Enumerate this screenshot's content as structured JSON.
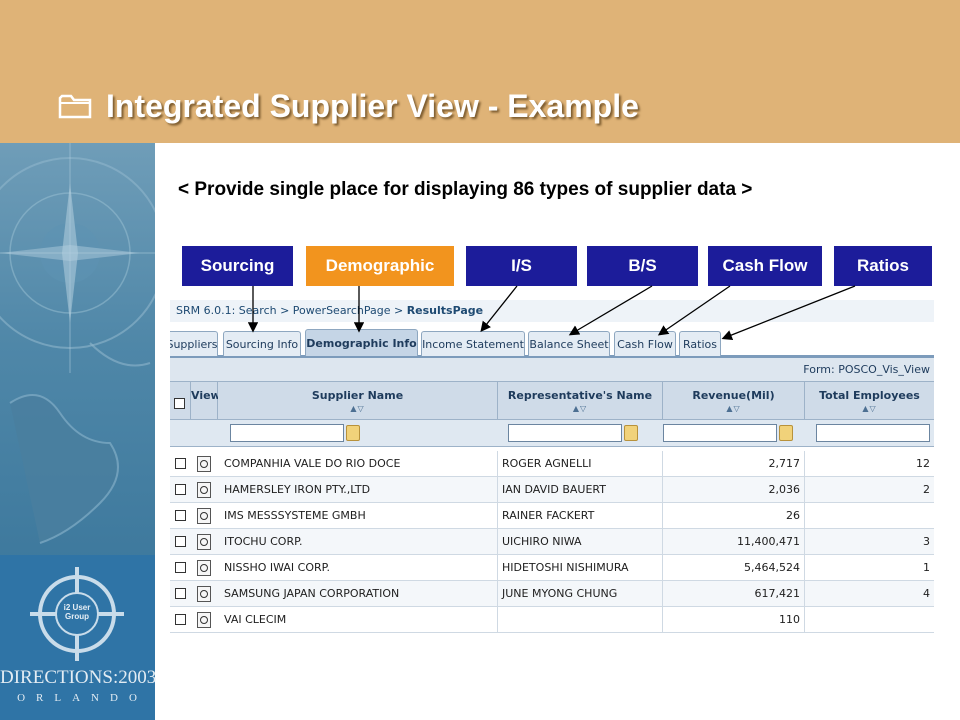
{
  "slide": {
    "title": "Integrated Supplier View - Example",
    "subtitle": "< Provide single place for displaying 86 types of supplier data >"
  },
  "categories": [
    {
      "label": "Sourcing",
      "color": "#1c1c9a"
    },
    {
      "label": "Demographic",
      "color": "#f2941e"
    },
    {
      "label": "I/S",
      "color": "#1c1c9a"
    },
    {
      "label": "B/S",
      "color": "#1c1c9a"
    },
    {
      "label": "Cash Flow",
      "color": "#1c1c9a"
    },
    {
      "label": "Ratios",
      "color": "#1c1c9a"
    }
  ],
  "logo": {
    "group_text": "i2 User Group",
    "title": "DIRECTIONS:2003",
    "subtitle": "ORLANDO"
  },
  "app": {
    "breadcrumb_prefix": "SRM 6.0.1: Search > PowerSearchPage > ",
    "breadcrumb_current": "ResultsPage",
    "tabs": [
      "Suppliers",
      "Sourcing Info",
      "Demographic Info",
      "Income Statement",
      "Balance Sheet",
      "Cash Flow",
      "Ratios"
    ],
    "active_tab": "Demographic Info",
    "form_label": "Form:  POSCO_Vis_View",
    "columns": {
      "view": "View",
      "supplier_name": "Supplier Name",
      "representative": "Representative's Name",
      "revenue": "Revenue(Mil)",
      "employees": "Total Employees"
    },
    "sort_glyph": "▲▽",
    "rows": [
      {
        "supplier": "COMPANHIA VALE DO RIO DOCE",
        "rep": "ROGER AGNELLI",
        "revenue": "2,717",
        "employees": "12"
      },
      {
        "supplier": "HAMERSLEY IRON PTY.,LTD",
        "rep": "IAN DAVID BAUERT",
        "revenue": "2,036",
        "employees": "2"
      },
      {
        "supplier": "IMS MESSSYSTEME GMBH",
        "rep": "RAINER FACKERT",
        "revenue": "26",
        "employees": ""
      },
      {
        "supplier": "ITOCHU CORP.",
        "rep": "UICHIRO NIWA",
        "revenue": "11,400,471",
        "employees": "3"
      },
      {
        "supplier": "NISSHO IWAI CORP.",
        "rep": "HIDETOSHI NISHIMURA",
        "revenue": "5,464,524",
        "employees": "1"
      },
      {
        "supplier": "SAMSUNG JAPAN CORPORATION",
        "rep": "JUNE MYONG CHUNG",
        "revenue": "617,421",
        "employees": "4"
      },
      {
        "supplier": "VAI CLECIM",
        "rep": "",
        "revenue": "110",
        "employees": ""
      }
    ]
  }
}
